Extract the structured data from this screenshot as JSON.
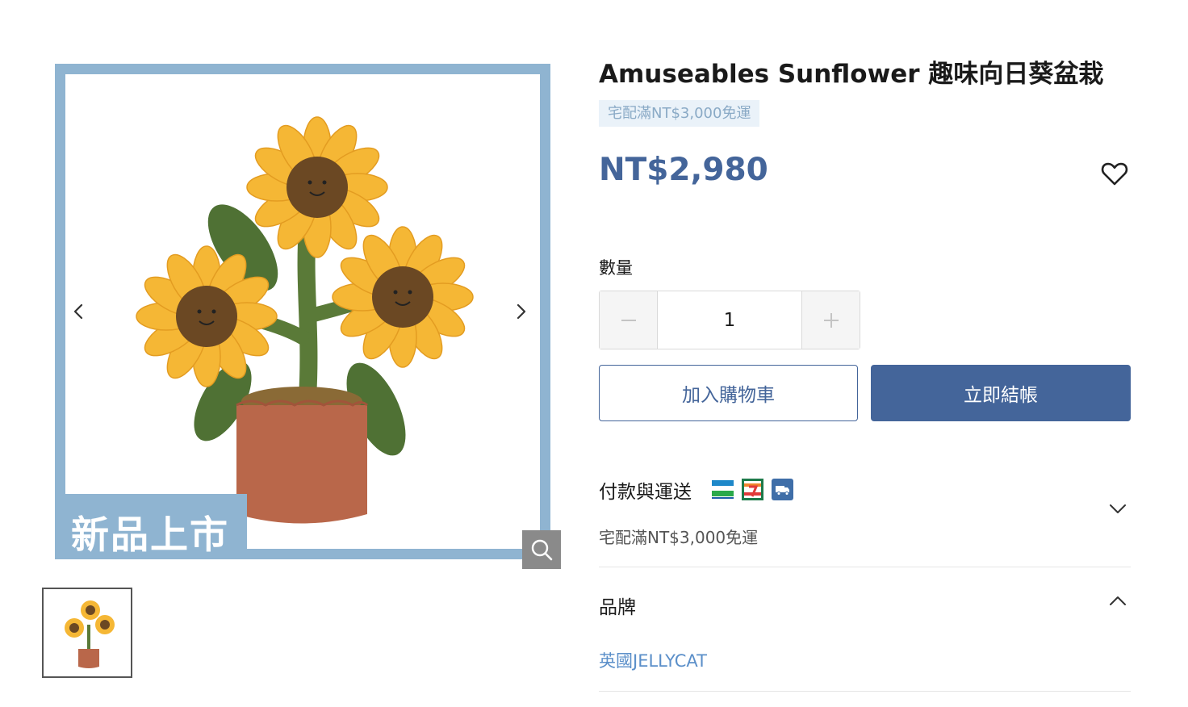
{
  "gallery": {
    "badge_text": "新品上市",
    "prev_icon": "chevron-left-icon",
    "next_icon": "chevron-right-icon",
    "zoom_icon": "magnifier-icon",
    "frame_color": "#8fb4d1"
  },
  "product": {
    "title": "Amuseables Sunflower 趣味向日葵盆栽",
    "shipping_tag": "宅配滿NT$3,000免運",
    "price": "NT$2,980",
    "wishlist_icon": "heart-outline-icon",
    "price_color": "#44659a"
  },
  "quantity": {
    "label": "數量",
    "value": "1",
    "decrement_icon": "minus-icon",
    "increment_icon": "plus-icon"
  },
  "actions": {
    "add_to_cart": "加入購物車",
    "buy_now": "立即結帳",
    "accent_color": "#44659a"
  },
  "payment": {
    "title": "付款與運送",
    "icons": [
      "familymart-icon",
      "seven-eleven-icon",
      "delivery-truck-icon"
    ],
    "subtitle": "宅配滿NT$3,000免運",
    "expanded": false
  },
  "brand": {
    "title": "品牌",
    "name": "英國JELLYCAT",
    "expanded": true
  }
}
